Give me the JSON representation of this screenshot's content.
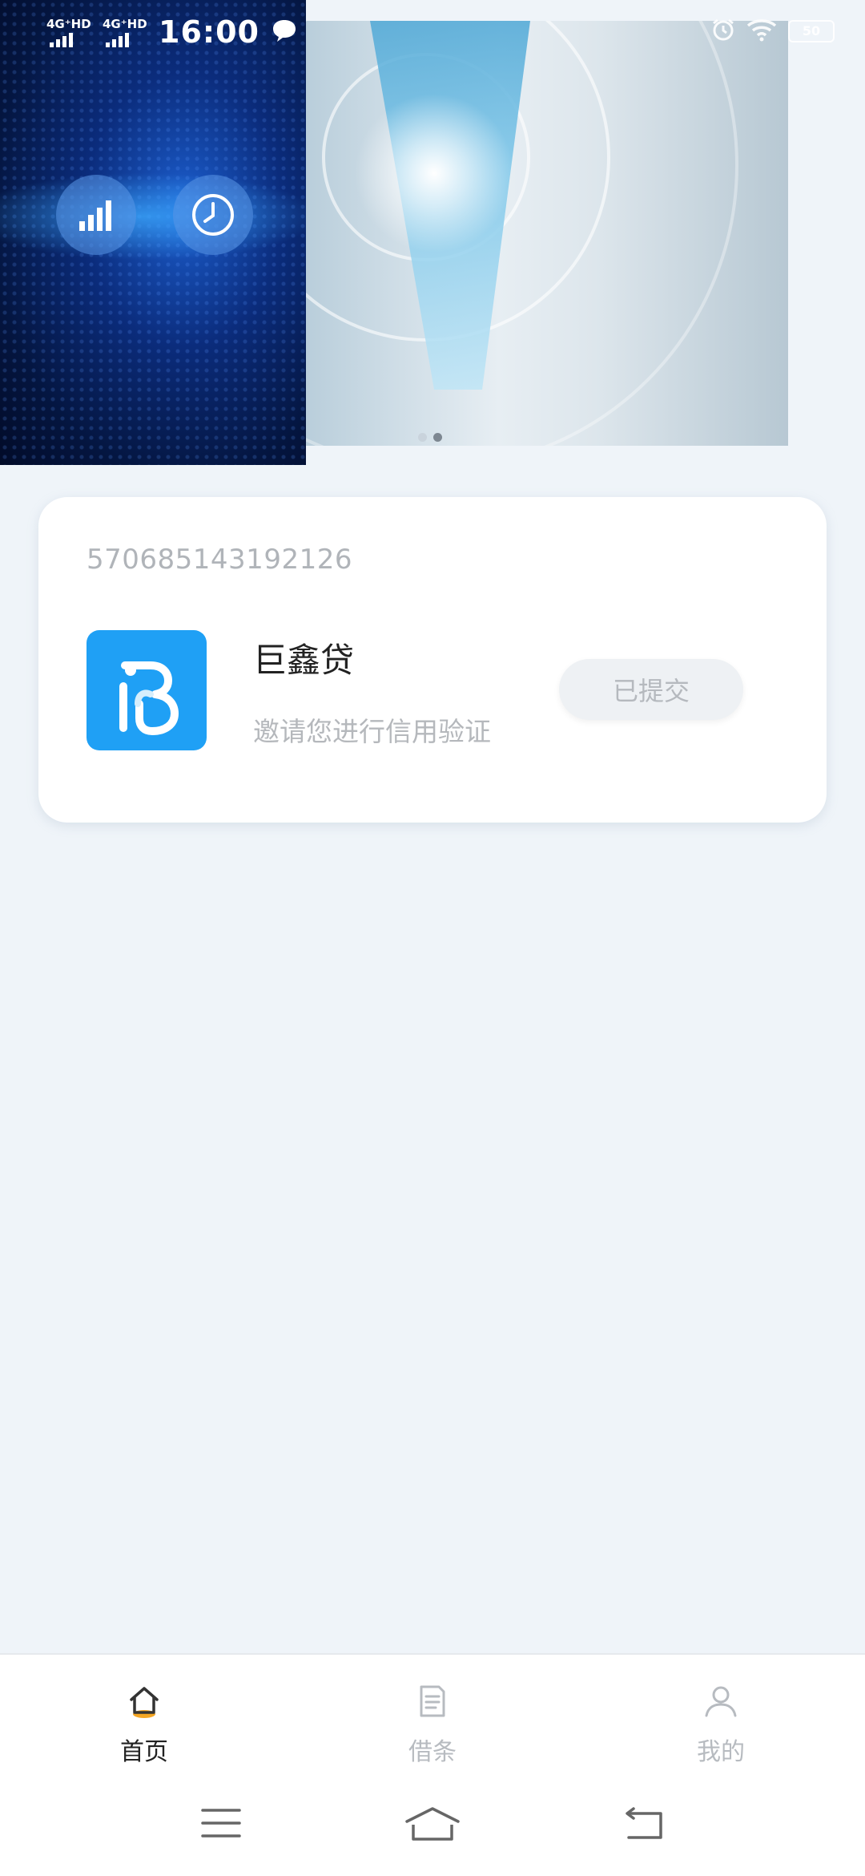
{
  "status_bar": {
    "network_1": "4G⁺HD",
    "network_2": "4G⁺HD",
    "time": "16:00",
    "battery": "50"
  },
  "card": {
    "id_number": "570685143192126",
    "app_name": "巨鑫贷",
    "description": "邀请您进行信用验证",
    "button_label": "已提交"
  },
  "tabs": [
    {
      "label": "首页",
      "icon": "home-icon",
      "active": true
    },
    {
      "label": "借条",
      "icon": "document-icon",
      "active": false
    },
    {
      "label": "我的",
      "icon": "user-icon",
      "active": false
    }
  ],
  "colors": {
    "background": "#eff4f9",
    "accent": "#f5a623",
    "logo_blue": "#1fa0f5"
  }
}
